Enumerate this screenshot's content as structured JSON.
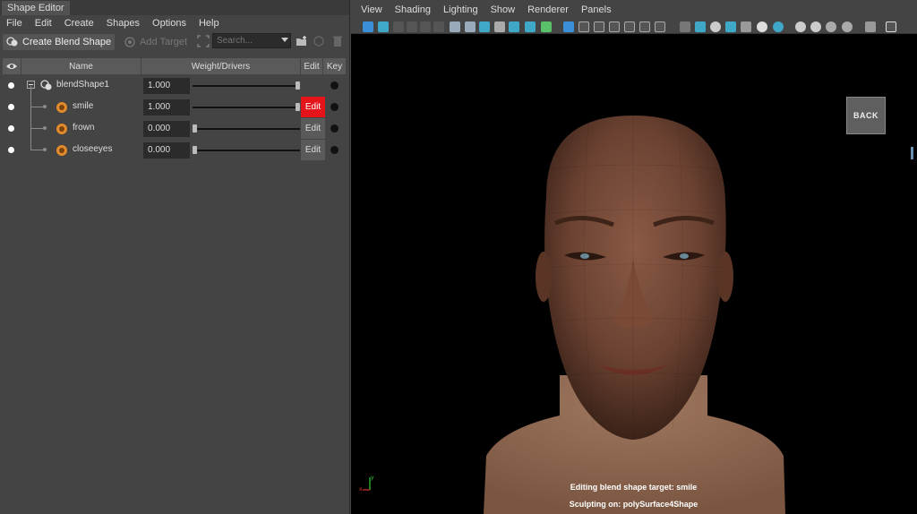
{
  "editor": {
    "tab_title": "Shape Editor",
    "menu": [
      "File",
      "Edit",
      "Create",
      "Shapes",
      "Options",
      "Help"
    ],
    "toolbar": {
      "create_blend_shape": "Create Blend Shape",
      "add_target": "Add Target",
      "search_placeholder": "Search..."
    },
    "columns": {
      "name": "Name",
      "weight": "Weight/Drivers",
      "edit": "Edit",
      "key": "Key"
    },
    "rows": [
      {
        "name": "blendShape1",
        "value": "1.000",
        "weight": 1.0,
        "edit": "",
        "editing": false
      },
      {
        "name": "smile",
        "value": "1.000",
        "weight": 1.0,
        "edit": "Edit",
        "editing": true
      },
      {
        "name": "frown",
        "value": "0.000",
        "weight": 0.0,
        "edit": "Edit",
        "editing": false
      },
      {
        "name": "closeeyes",
        "value": "0.000",
        "weight": 0.0,
        "edit": "Edit",
        "editing": false
      }
    ]
  },
  "viewport": {
    "menu": [
      "View",
      "Shading",
      "Lighting",
      "Show",
      "Renderer",
      "Panels"
    ],
    "back_label": "BACK",
    "hud_line1": "Editing blend shape target: smile",
    "hud_line2": "Sculpting on: polySurface4Shape",
    "axis_x": "x",
    "axis_y": "y"
  },
  "colors": {
    "edit_active": "#e4141a",
    "target_icon": "#e08a2a"
  }
}
